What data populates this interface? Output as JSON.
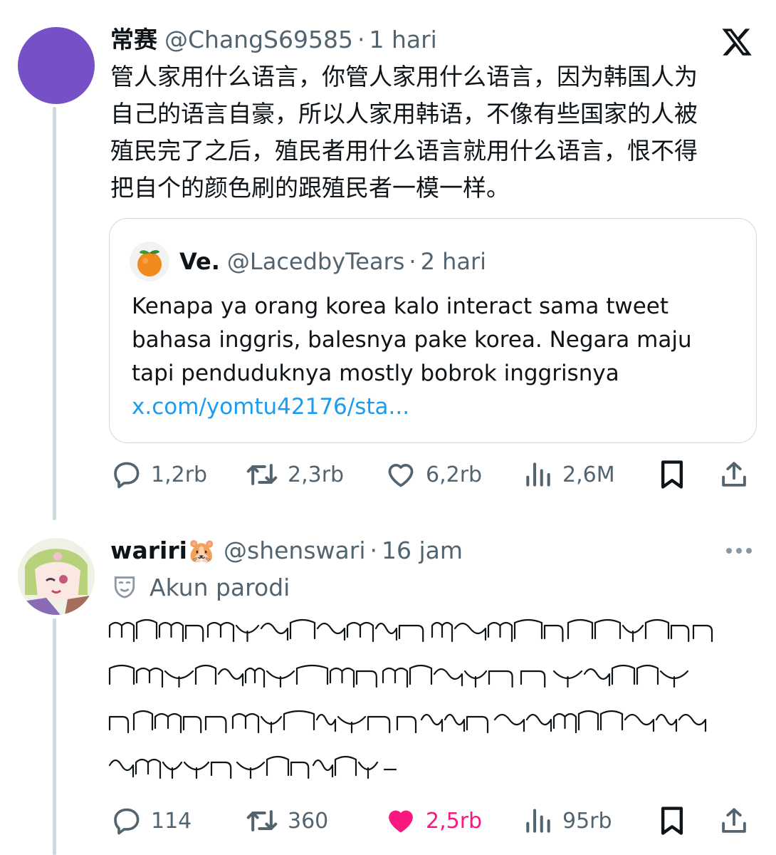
{
  "brand": {
    "icon": "x-logo-icon"
  },
  "colors": {
    "thread_line": "#cfd9de",
    "avatar1": "#7550c7",
    "link": "#1d9bf0",
    "like_active": "#f91880",
    "muted": "#536471"
  },
  "tweet1": {
    "display_name": "常赛",
    "handle": "@ChangS69585",
    "separator": "·",
    "time": "1 hari",
    "text_lines": [
      "管人家用什么语言，你管人家用什么语言，因为韩国人为",
      "自己的语言自豪，所以人家用韩语，不像有些国家的人被",
      "殖民完了之后，殖民者用什么语言就用什么语言，恨不得",
      "把自个的颜色刷的跟殖民者一模一样。"
    ],
    "quote": {
      "avatar_icon": "tangerine-icon",
      "display_name": "Ve.",
      "handle": "@LacedbyTears",
      "separator": "·",
      "time": "2 hari",
      "text_lines": [
        "Kenapa ya orang korea kalo interact sama tweet",
        "bahasa inggris, balesnya pake korea. Negara maju",
        "tapi penduduknya mostly bobrok inggrisnya"
      ],
      "link": "x.com/yomtu42176/sta..."
    },
    "actions": {
      "replies": "1,2rb",
      "reposts": "2,3rb",
      "likes": "6,2rb",
      "views": "2,6M"
    }
  },
  "tweet2": {
    "display_name": "wariri🐹",
    "handle": "@shenswari",
    "separator": "·",
    "time": "16 jam",
    "badge_icon": "theater-mask-icon",
    "badge": "Akun parodi",
    "script": "Javanese script (handwritten-style) — 4 lines",
    "actions": {
      "replies": "114",
      "reposts": "360",
      "likes": "2,5rb",
      "views": "95rb"
    }
  }
}
